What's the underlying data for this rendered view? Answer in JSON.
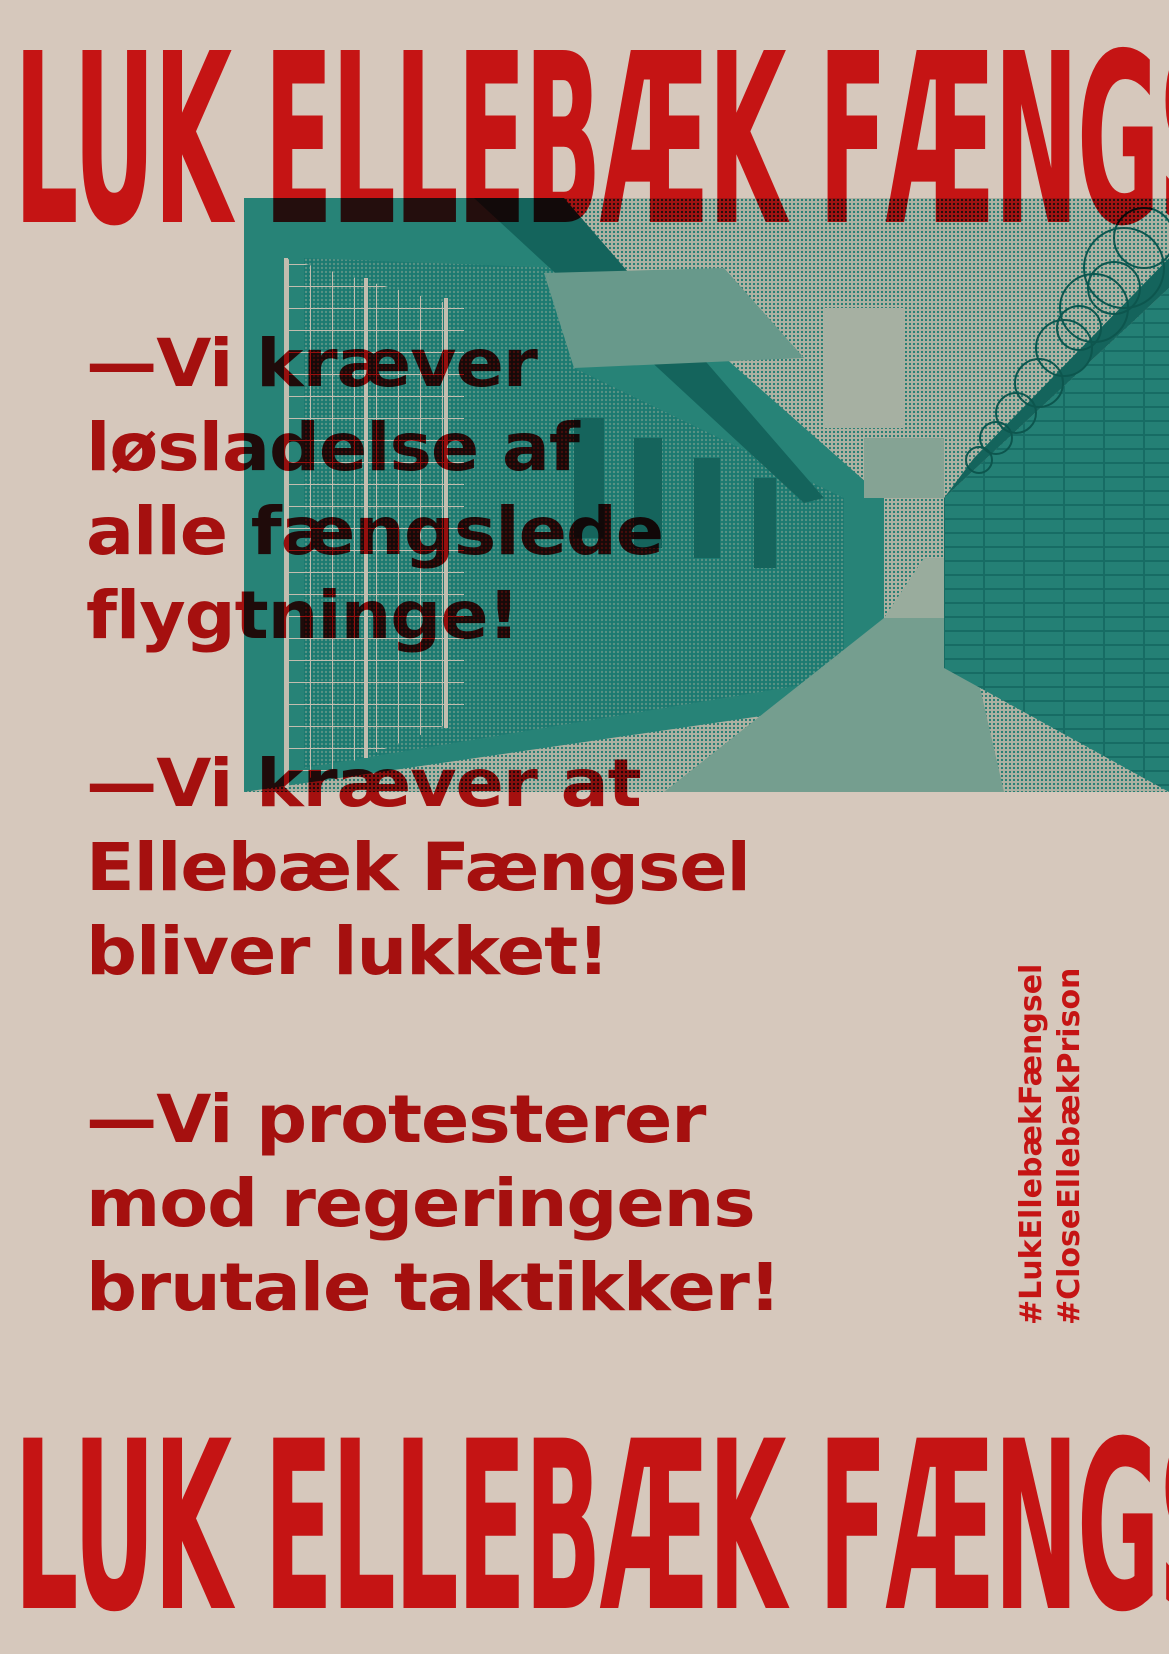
{
  "poster": {
    "headline_top": "LUK ELLEBÆK FÆNGSEL",
    "headline_bottom": "LUK ELLEBÆK FÆNGSEL",
    "demands": [
      {
        "lines": [
          "—Vi kræver",
          "løsladelse af",
          "alle fængslede",
          "flygtninge!"
        ]
      },
      {
        "lines": [
          "—Vi kræver at",
          "Ellebæk Fængsel",
          "bliver lukket!"
        ]
      },
      {
        "lines": [
          "—Vi protesterer",
          "mod regeringens",
          "brutale taktikker!"
        ]
      }
    ],
    "hashtags": [
      "#LukEllebækFængsel",
      "#CloseEllebækPrison"
    ],
    "photo_icon": "prison-yard-photo",
    "colors": {
      "background": "#d6c8bc",
      "red": "#c51414",
      "teal": "#1f9b98"
    }
  }
}
